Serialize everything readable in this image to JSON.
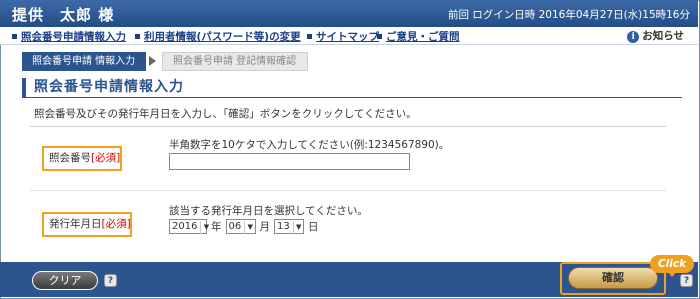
{
  "header": {
    "user_name": "提供　太郎 様",
    "last_login": "前回 ログイン日時 2016年04月27日(水)15時16分"
  },
  "nav": {
    "items": [
      "照会番号申請情報入力",
      "利用者情報(パスワード等)の変更",
      "サイトマップ",
      "ご意見・ご質問"
    ],
    "notice": "お知らせ"
  },
  "steps": {
    "active": "照会番号申請 情報入力",
    "next": "照会番号申請 登記情報確認"
  },
  "page": {
    "title": "照会番号申請情報入力",
    "instruction": "照会番号及びその発行年月日を入力し、「確認」ボタンをクリックしてください。"
  },
  "form": {
    "number": {
      "label": "照会番号",
      "required": "[必須]",
      "hint": "半角数字を10ケタで入力してください(例:1234567890)。",
      "value": ""
    },
    "date": {
      "label": "発行年月日",
      "required": "[必須]",
      "hint": "該当する発行年月日を選択してください。",
      "year": "2016",
      "year_unit": "年",
      "month": "06",
      "month_unit": "月",
      "day": "13",
      "day_unit": "日"
    }
  },
  "footer": {
    "clear_label": "クリア",
    "confirm_label": "確認",
    "help": "?",
    "click_badge": "Click"
  },
  "colors": {
    "accent": "#2c5590",
    "highlight": "#f0a020",
    "required": "#d00000"
  }
}
